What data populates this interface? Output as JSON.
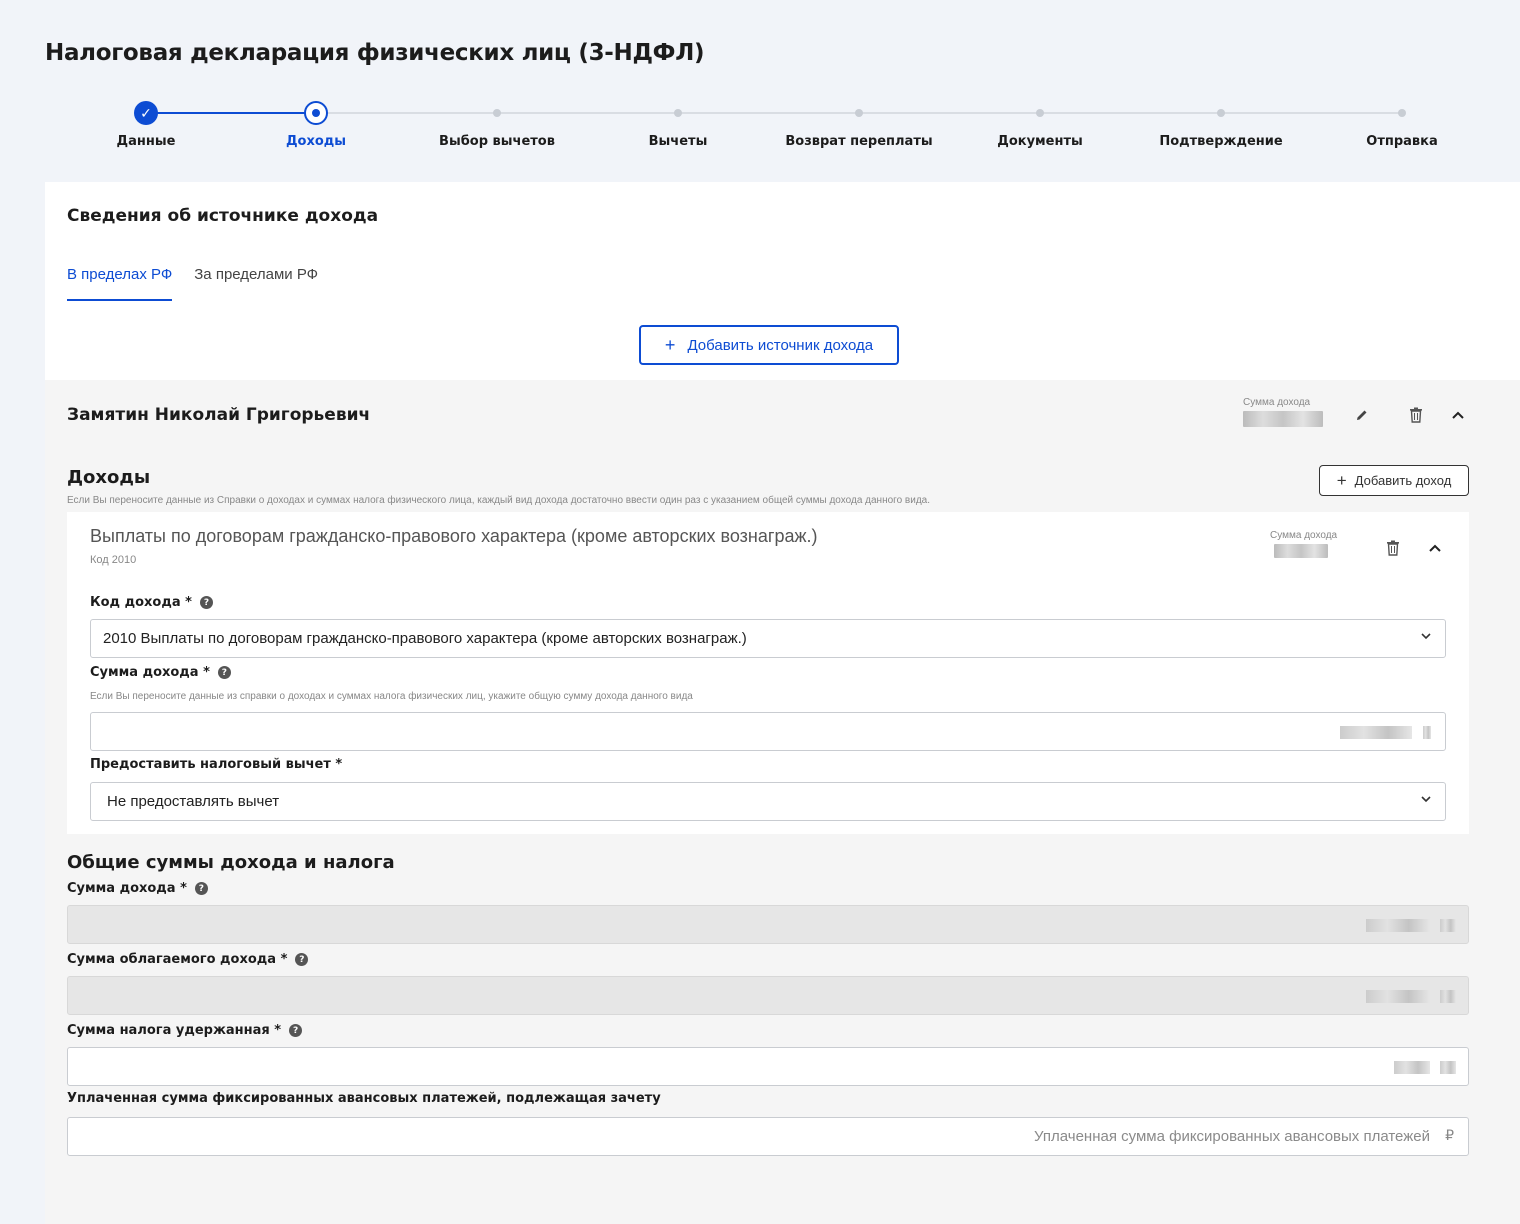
{
  "page": {
    "title": "Налоговая декларация физических лиц (3-НДФЛ)"
  },
  "stepper": {
    "steps": [
      {
        "label": "Данные",
        "state": "done"
      },
      {
        "label": "Доходы",
        "state": "active"
      },
      {
        "label": "Выбор вычетов",
        "state": "pending"
      },
      {
        "label": "Вычеты",
        "state": "pending"
      },
      {
        "label": "Возврат переплаты",
        "state": "pending"
      },
      {
        "label": "Документы",
        "state": "pending"
      },
      {
        "label": "Подтверждение",
        "state": "pending"
      },
      {
        "label": "Отправка",
        "state": "pending"
      }
    ]
  },
  "source": {
    "title": "Сведения об источнике дохода",
    "tabs": [
      {
        "label": "В пределах РФ",
        "active": true
      },
      {
        "label": "За пределами РФ",
        "active": false
      }
    ],
    "add_button": "Добавить источник дохода",
    "add_icon": "plus-icon"
  },
  "employer": {
    "name": "Замятин Николай Григорьевич",
    "sum_caption": "Сумма дохода"
  },
  "incomes": {
    "title": "Доходы",
    "hint": "Если Вы переносите данные из Справки о доходах и суммах налога физического лица, каждый вид дохода достаточно ввести один раз с указанием общей суммы дохода данного вида.",
    "add_button": "Добавить доход",
    "item": {
      "title": "Выплаты по договорам гражданско-правового характера (кроме авторских вознаграж.)",
      "code": "Код 2010",
      "sum_caption": "Сумма дохода",
      "code_label": "Код дохода *",
      "code_value": "2010 Выплаты по договорам гражданско-правового характера (кроме авторских вознаграж.)",
      "sum_label": "Сумма дохода *",
      "sum_hint": "Если Вы переносите данные из справки о доходах и суммах налога физических лиц, укажите общую сумму дохода данного вида",
      "deduction_label": "Предоставить налоговый вычет  *",
      "deduction_value": "Не предоставлять вычет"
    }
  },
  "totals": {
    "title": "Общие суммы дохода и налога",
    "income_label": "Сумма дохода *",
    "taxable_label": "Сумма облагаемого дохода *",
    "withheld_label": "Сумма налога удержанная *",
    "advance_label": "Уплаченная сумма фиксированных авансовых платежей, подлежащая зачету",
    "advance_placeholder": "Уплаченная сумма фиксированных авансовых платежей",
    "currency": "₽"
  },
  "colors": {
    "accent": "#0d4cd3",
    "background": "#f1f4f9"
  }
}
